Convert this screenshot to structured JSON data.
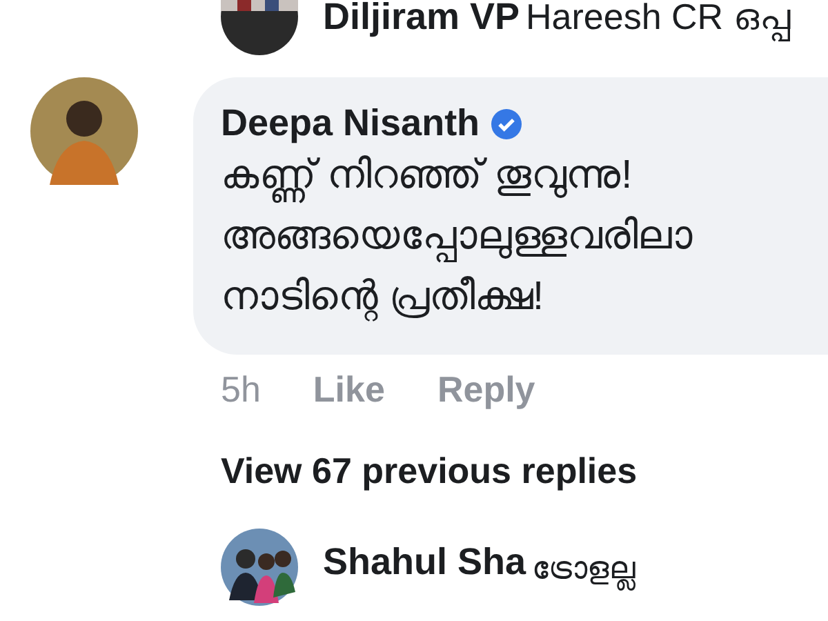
{
  "comments": [
    {
      "author": "Diljiram VP",
      "text": "Hareesh CR ഒപ്പ",
      "kind": "clipped"
    },
    {
      "author": "Deepa Nisanth",
      "verified": true,
      "kind": "bubble",
      "lines": [
        "കണ്ണ് നിറഞ്ഞ് തൂവുന്നു!",
        "അങ്ങയെപ്പോലുള്ളവരിലാ",
        "നാടിന്റെ പ്രതീക്ഷ!"
      ],
      "time": "5h",
      "actions": [
        "Like",
        "Reply"
      ]
    },
    {
      "kind": "more",
      "text": "View 67 previous replies"
    },
    {
      "author": "Shahul Sha",
      "text": "ട്രോളല്ല",
      "kind": "inline"
    }
  ]
}
